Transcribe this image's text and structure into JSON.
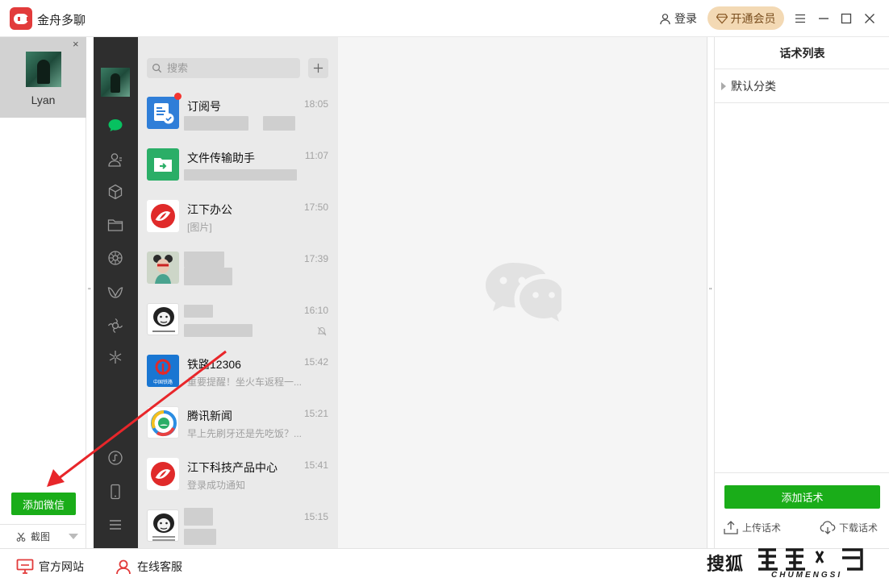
{
  "app": {
    "title": "金舟多聊"
  },
  "titlebar": {
    "login": "登录",
    "vip": "开通会员"
  },
  "account": {
    "name": "Lyan",
    "close": "×"
  },
  "left": {
    "add_wechat": "添加微信",
    "screenshot": "截图"
  },
  "search": {
    "placeholder": "搜索"
  },
  "chats": [
    {
      "name": "订阅号",
      "time": "18:05",
      "preview": "",
      "avatar": "subscription-avatar",
      "unread": true
    },
    {
      "name": "文件传输助手",
      "time": "11:07",
      "preview": "",
      "avatar": "file-transfer-avatar"
    },
    {
      "name": "江下办公",
      "time": "17:50",
      "preview": "[图片]",
      "avatar": "jiangxia-logo-avatar"
    },
    {
      "name": "",
      "time": "17:39",
      "preview": "",
      "avatar": "girl-avatar"
    },
    {
      "name": "",
      "time": "16:10",
      "preview": "",
      "avatar": "meme-avatar",
      "muted": true
    },
    {
      "name": "铁路12306",
      "time": "15:42",
      "preview": "重要提醒！坐火车返程一...",
      "avatar": "railway-avatar",
      "avatar_text": "中国铁路"
    },
    {
      "name": "腾讯新闻",
      "time": "15:21",
      "preview": "早上先刷牙还是先吃饭？...",
      "avatar": "tencent-news-avatar"
    },
    {
      "name": "江下科技产品中心",
      "time": "15:41",
      "preview": "登录成功通知",
      "avatar": "jiangxia-logo-avatar"
    },
    {
      "name": "",
      "time": "15:15",
      "preview": "",
      "avatar": "meme-avatar"
    }
  ],
  "right_panel": {
    "title": "话术列表",
    "category": "默认分类",
    "add_script": "添加话术",
    "upload": "上传话术",
    "download": "下载话术"
  },
  "bottom": {
    "website": "官方网站",
    "service": "在线客服"
  },
  "watermark": {
    "brand": "搜狐",
    "sub": "CHUMENGSI"
  },
  "colors": {
    "accent_green": "#1aad19",
    "brand_red": "#e23b3b",
    "vip_gold": "#f3d9b4",
    "wechat_sidebar": "#2e2e2e",
    "annotation_arrow": "#e8262a"
  }
}
